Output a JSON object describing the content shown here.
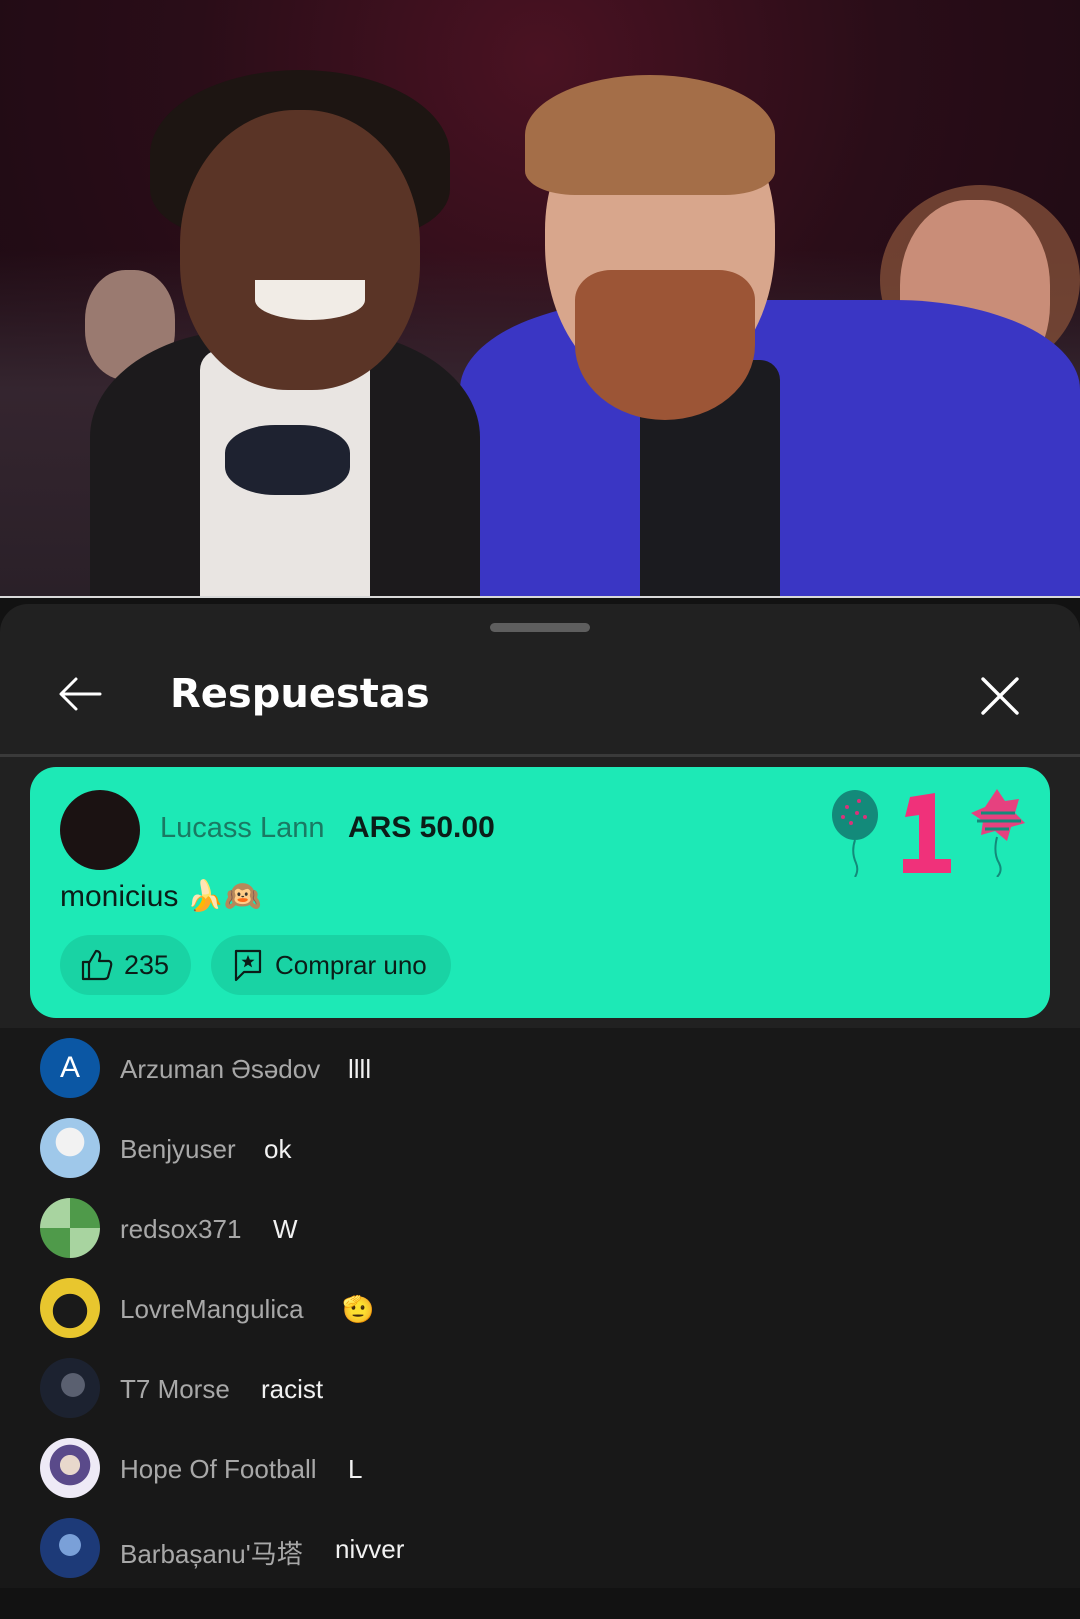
{
  "sheet": {
    "title": "Respuestas"
  },
  "superchat": {
    "author": "Lucass Lann",
    "amount": "ARS 50.00",
    "message": "monicius 🍌🙉",
    "likes": "235",
    "buy_label": "Comprar uno",
    "background_color": "#1de9b6"
  },
  "replies": [
    {
      "author": "Arzuman Əsədov",
      "message": "llll",
      "avatar_letter": "A",
      "avatar_color": "#0b57a4"
    },
    {
      "author": "Benjyuser",
      "message": "ok",
      "avatar_letter": "",
      "avatar_color": "#6db0e0"
    },
    {
      "author": "redsox371",
      "message": "W",
      "avatar_letter": "",
      "avatar_color": "#3f8a3f"
    },
    {
      "author": "LovreMangulica",
      "message": "🫡",
      "avatar_letter": "",
      "avatar_color": "#e5c52a"
    },
    {
      "author": "T7 Morse",
      "message": "racist",
      "avatar_letter": "",
      "avatar_color": "#2a3040"
    },
    {
      "author": "Hope Of Football",
      "message": "L",
      "avatar_letter": "",
      "avatar_color": "#d8d4e8"
    },
    {
      "author": "Barbașanu'马塔",
      "message": "nivver",
      "avatar_letter": "",
      "avatar_color": "#2a4a8a"
    }
  ],
  "icons": {
    "back": "arrow-left-icon",
    "close": "close-icon",
    "like": "thumbs-up-icon",
    "buy": "superchat-icon"
  }
}
